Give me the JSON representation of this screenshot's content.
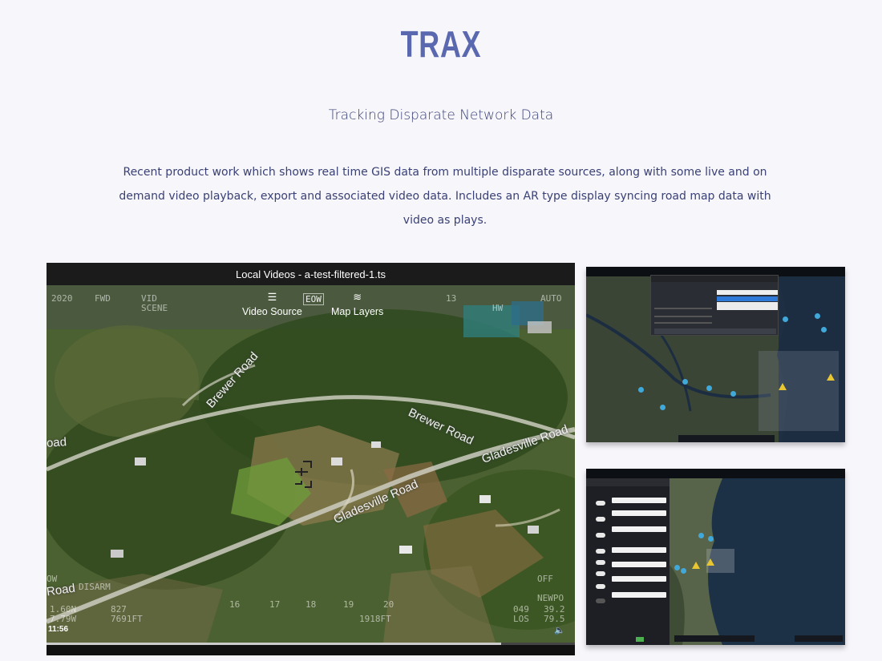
{
  "page": {
    "title": "TRAX",
    "subtitle": "Tracking Disparate Network Data",
    "description": "Recent product work which shows real time GIS data from multiple disparate sources, along with some live and on demand video playback, export and associated video data.  Includes an AR type display syncing road map data with video as plays."
  },
  "video": {
    "title": "Local Videos - a-test-filtered-1.ts",
    "video_source_label": "Video Source",
    "map_layers_label": "Map Layers",
    "video_source_icon": "hamburger-menu-icon",
    "map_layers_icon": "layers-icon",
    "time": "11:56",
    "progress": 0.86,
    "roads": [
      "Brewer Road",
      "Brewer Road",
      "Gladesville Road",
      "Gladesville Road",
      "oad",
      "Road"
    ],
    "hud": {
      "top_left": "2020",
      "top_fwd": "FWD",
      "top_vid": "VID",
      "top_scene": "SCENE",
      "top_eow": "EOW",
      "top_13": "13",
      "top_hw": "HW",
      "top_a": "AUTO",
      "left_mid": "DISARM",
      "bottom_left_1": "1.60N",
      "bottom_left_2": "7.79W",
      "bottom_left_3": "827",
      "bottom_left_4": "7691FT",
      "bottom_16": "16",
      "bottom_17": "17",
      "bottom_18": "18",
      "bottom_19": "19",
      "bottom_20": "20",
      "bottom_right_off": "OFF",
      "bottom_right_newpo": "NEWPO",
      "bottom_right_049": "049",
      "bottom_right_los": "LOS",
      "bottom_right_39": "39.2",
      "bottom_right_79": "79.5",
      "bottom_191": "1918FT",
      "ow": "OW"
    },
    "volume_icon": "volume-icon"
  },
  "colors": {
    "title": "#5a68b0",
    "text": "#3a4175",
    "background": "#f7f6fb"
  }
}
